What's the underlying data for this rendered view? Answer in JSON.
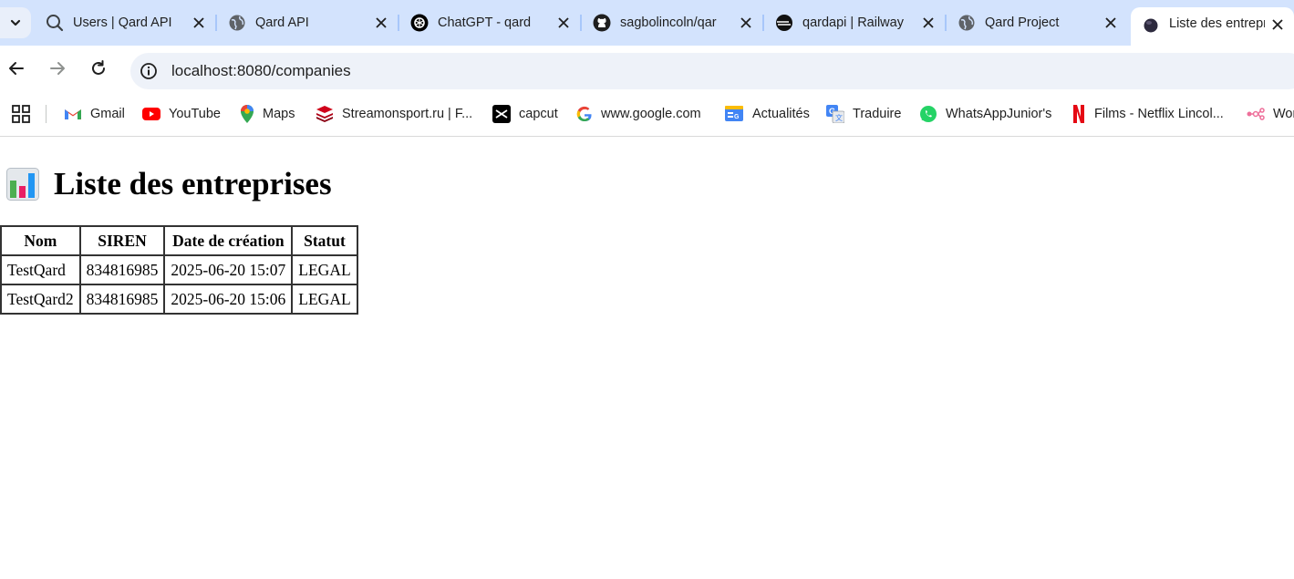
{
  "browser": {
    "tabs": [
      {
        "title": "Users | Qard API",
        "favicon": "qard-q-icon"
      },
      {
        "title": "Qard API",
        "favicon": "globe-icon"
      },
      {
        "title": "ChatGPT - qard",
        "favicon": "chatgpt-icon"
      },
      {
        "title": "sagbolincoln/qar",
        "favicon": "github-icon"
      },
      {
        "title": "qardapi | Railway",
        "favicon": "railway-icon"
      },
      {
        "title": "Qard Project",
        "favicon": "globe-icon"
      },
      {
        "title": "Liste des entrepri",
        "favicon": "dark-dot-icon",
        "active": true
      }
    ],
    "url": "localhost:8080/companies",
    "bookmarks": [
      {
        "label": "Gmail",
        "icon": "gmail-icon"
      },
      {
        "label": "YouTube",
        "icon": "youtube-icon"
      },
      {
        "label": "Maps",
        "icon": "maps-icon"
      },
      {
        "label": "Streamonsport.ru | F...",
        "icon": "streamonsport-icon"
      },
      {
        "label": "capcut",
        "icon": "capcut-icon"
      },
      {
        "label": "www.google.com",
        "icon": "google-icon"
      },
      {
        "label": "Actualités",
        "icon": "news-icon"
      },
      {
        "label": "Traduire",
        "icon": "translate-icon"
      },
      {
        "label": "WhatsAppJunior's",
        "icon": "whatsapp-icon"
      },
      {
        "label": "Films - Netflix Lincol...",
        "icon": "netflix-icon"
      },
      {
        "label": "Wor",
        "icon": "workflow-icon"
      }
    ]
  },
  "page": {
    "heading": "Liste des entreprises",
    "heading_icon": "bar-chart-icon",
    "table": {
      "headers": [
        "Nom",
        "SIREN",
        "Date de création",
        "Statut"
      ],
      "rows": [
        [
          "TestQard",
          "834816985",
          "2025-06-20 15:07",
          "LEGAL"
        ],
        [
          "TestQard2",
          "834816985",
          "2025-06-20 15:06",
          "LEGAL"
        ]
      ]
    }
  },
  "colors": {
    "tabstrip_bg": "#d3e3fd",
    "omnibox_bg": "#eef2f9",
    "table_border": "#333333"
  }
}
